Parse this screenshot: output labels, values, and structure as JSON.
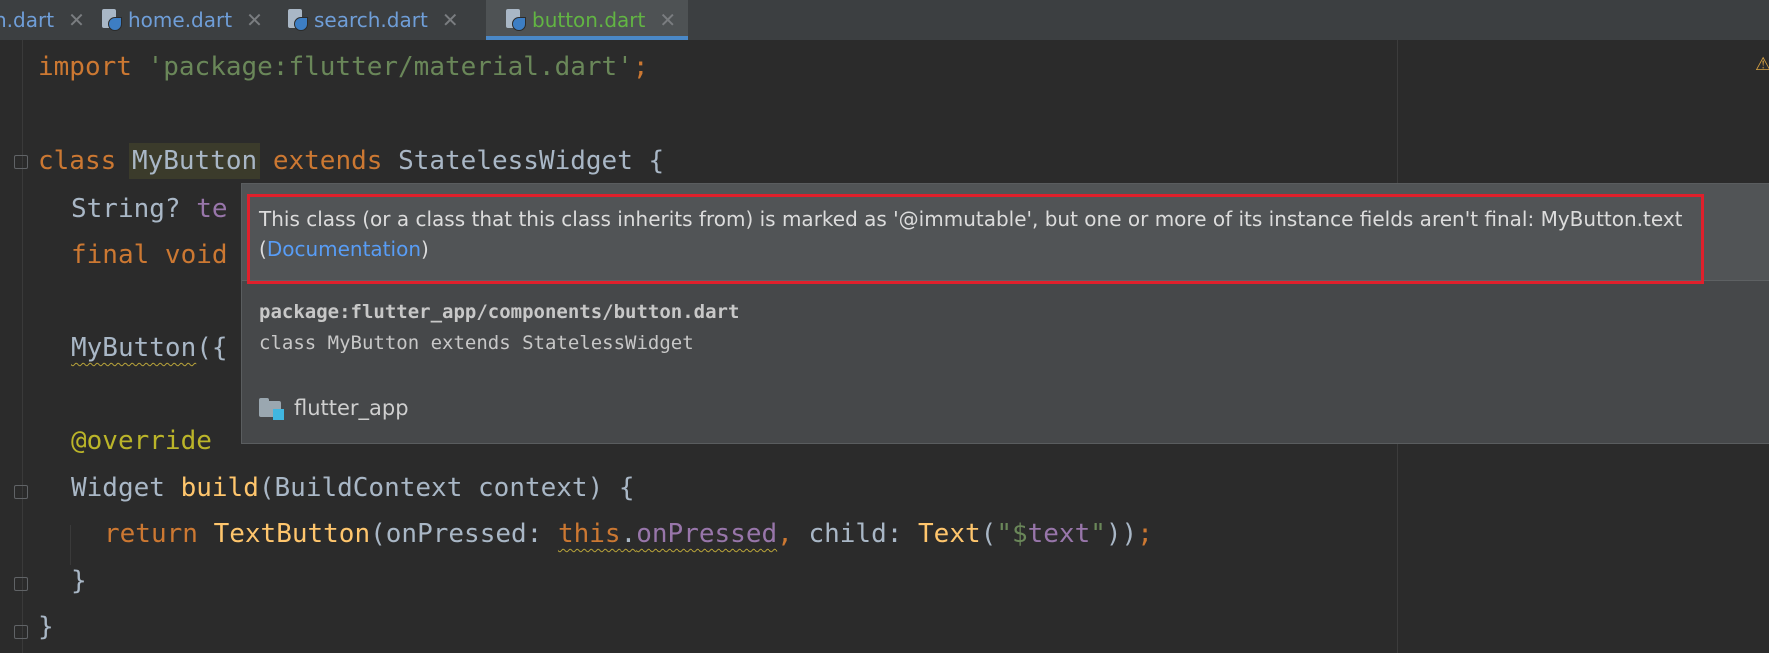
{
  "tabs": [
    {
      "label": "n.dart",
      "active": false
    },
    {
      "label": "home.dart",
      "active": false
    },
    {
      "label": "search.dart",
      "active": false
    },
    {
      "label": "button.dart",
      "active": true
    }
  ],
  "tab_close_glyph": "✕",
  "code": {
    "l1_import": "import",
    "l1_string": "'package:flutter/material.dart'",
    "l1_semicolon": ";",
    "l3_class": "class",
    "l3_name": "MyButton",
    "l3_extends": "extends",
    "l3_parent": "StatelessWidget",
    "l3_brace": " {",
    "l4_type": "String? ",
    "l4_field": "te",
    "l5_final": "final void",
    "l7_ctor": "MyButton",
    "l7_paren": "({",
    "l9_annotation": "@",
    "l9_override": "override",
    "l10_type": "Widget ",
    "l10_method": "build",
    "l10_params": "(BuildContext context) {",
    "l11_return": "return ",
    "l11_textbutton": "TextButton",
    "l11_open": "(onPressed: ",
    "l11_this": "this",
    "l11_dot": ".",
    "l11_onpressed": "onPressed",
    "l11_comma": ",",
    "l11_child": " child: ",
    "l11_text": "Text",
    "l11_paren_open": "(",
    "l11_str_open": "\"$",
    "l11_var": "text",
    "l11_str_close": "\"",
    "l11_close": "))",
    "l11_semicolon": ";",
    "l12_close": "}",
    "l13_close": "}"
  },
  "popup": {
    "message": "This class (or a class that this class inherits from) is marked as '@immutable', but one or more of its instance fields aren't final: MyButton.text",
    "doc_open": "(",
    "doc_link": "Documentation",
    "doc_close": ")",
    "package": "package:flutter_app/components/button.dart",
    "declaration": "class MyButton extends StatelessWidget",
    "module": "flutter_app"
  },
  "colors": {
    "keyword": "#cc7832",
    "string": "#6a8759",
    "function": "#ffc66d",
    "field": "#9876aa",
    "annotation": "#bbb529",
    "link": "#589df6",
    "highlight_border": "#e0202c",
    "active_tab_text": "#62b543"
  },
  "icons": {
    "tab_file": "dart-file-icon",
    "module": "folder-module-icon",
    "warning": "warning-icon"
  }
}
